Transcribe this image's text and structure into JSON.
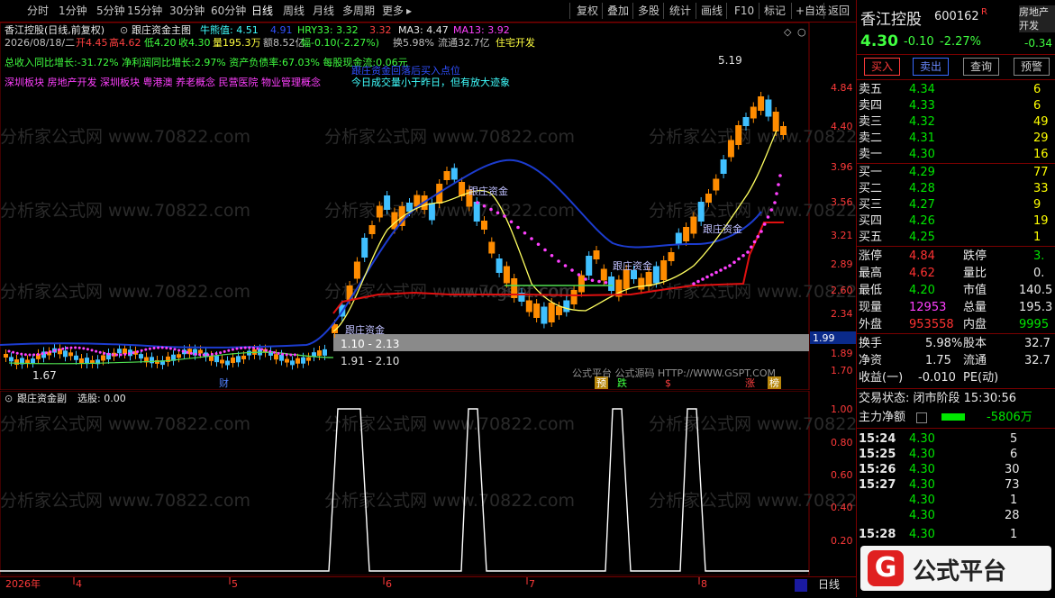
{
  "toolbar": {
    "periods": [
      "分时",
      "1分钟",
      "5分钟",
      "15分钟",
      "30分钟",
      "60分钟",
      "日线",
      "周线",
      "月线",
      "多周期",
      "更多"
    ],
    "actions": [
      "复权",
      "叠加",
      "多股",
      "统计",
      "画线",
      "F10",
      "标记",
      "+自选",
      "返回"
    ]
  },
  "header": {
    "stock_line": "香江控股(日线,前复权)",
    "indicator_name": "跟庄资金主图",
    "niu_xiong": "牛熊值: 4.51",
    "hidden_val": "4.91",
    "hry33": "HRY33: 3.32",
    "hry_val": "3.32",
    "ma3": "MA3: 4.47",
    "ma13": "MA13: 3.92",
    "date": "2026/08/18/二",
    "open": "开4.45",
    "high": "高4.62",
    "low": "低4.20",
    "close": "收4.30",
    "volume": "量195.3万",
    "amount": "额8.52亿",
    "amp": "幅-0.10(-2.27%)",
    "turnover": "换5.98%",
    "float": "流通32.7亿",
    "sector": "住宅开发",
    "fund_line": "总收入同比增长:-31.72%  净利润同比增长:2.97%  资产负债率:67.03%  每股现金流:0.06元",
    "concept_line": "深圳板块  房地产开发  深圳板块  粤港澳  养老概念  民营医院  物业管理概念",
    "note": "今日成交量小于昨日，但有放大迹象",
    "watermark_tip": "跟庄资金回落后买入点位"
  },
  "main_chart": {
    "price_ticks": [
      "4.84",
      "4.40",
      "3.96",
      "3.56",
      "3.21",
      "2.89",
      "2.60",
      "2.34",
      "2.10",
      "1.89",
      "1.70"
    ],
    "current_price_tag": "1.99",
    "high_label": "5.19",
    "low_label": "1.67",
    "box_top": "1.10 - 2.13",
    "box_bottom": "1.91 - 2.10",
    "annotations": [
      "跟庄资金",
      "跟庄资金",
      "跟庄资金",
      "跟庄资金"
    ],
    "event_markers": [
      "财",
      "预",
      "跌",
      "$",
      "涨",
      "榜"
    ],
    "source_text": "公式平台   公式源码 HTTP://WWW.GSPT.COM",
    "watermark": "分析家公式网 www.70822.com",
    "watermark2": "www.gspt.com"
  },
  "sub_chart": {
    "title": "跟庄资金副",
    "select_label": "选股: 0.00",
    "ticks": [
      "1.00",
      "0.80",
      "0.60",
      "0.40",
      "0.20"
    ]
  },
  "x_axis": {
    "labels": [
      "2026年",
      "4",
      "5",
      "6",
      "7",
      "8"
    ],
    "period_button": "日线"
  },
  "right_panel": {
    "name": "香江控股",
    "code": "600162",
    "flag": "R",
    "sector_tag": "房地产开发",
    "price": "4.30",
    "change": "-0.10",
    "pct": "-2.27%",
    "sector_change": "-0.34",
    "buttons": [
      "买入",
      "卖出",
      "查询",
      "预警"
    ],
    "asks": [
      {
        "label": "卖五",
        "price": "4.34",
        "vol": "6"
      },
      {
        "label": "卖四",
        "price": "4.33",
        "vol": "6"
      },
      {
        "label": "卖三",
        "price": "4.32",
        "vol": "49"
      },
      {
        "label": "卖二",
        "price": "4.31",
        "vol": "29"
      },
      {
        "label": "卖一",
        "price": "4.30",
        "vol": "16"
      }
    ],
    "bids": [
      {
        "label": "买一",
        "price": "4.29",
        "vol": "77"
      },
      {
        "label": "买二",
        "price": "4.28",
        "vol": "33"
      },
      {
        "label": "买三",
        "price": "4.27",
        "vol": "9"
      },
      {
        "label": "买四",
        "price": "4.26",
        "vol": "19"
      },
      {
        "label": "买五",
        "price": "4.25",
        "vol": "1"
      }
    ],
    "stats": [
      {
        "l1": "涨停",
        "v1": "4.84",
        "l2": "跌停",
        "v2": "3."
      },
      {
        "l1": "最高",
        "v1": "4.62",
        "l2": "量比",
        "v2": "0."
      },
      {
        "l1": "最低",
        "v1": "4.20",
        "l2": "市值",
        "v2": "140.5"
      },
      {
        "l1": "现量",
        "v1": "12953",
        "l2": "总量",
        "v2": "195.3"
      },
      {
        "l1": "外盘",
        "v1": "953558",
        "l2": "内盘",
        "v2": "9995"
      }
    ],
    "stats2": [
      {
        "l1": "换手",
        "v1": "5.98%",
        "l2": "股本",
        "v2": "32.7"
      },
      {
        "l1": "净资",
        "v1": "1.75",
        "l2": "流通",
        "v2": "32.7"
      },
      {
        "l1": "收益(一)",
        "v1": "-0.010",
        "l2": "PE(动)",
        "v2": ""
      }
    ],
    "trade_status": "交易状态: 闭市阶段  15:30:56",
    "main_net_label": "主力净额",
    "main_net_value": "-5806万",
    "ticks": [
      {
        "t": "15:24",
        "p": "4.30",
        "v": "5"
      },
      {
        "t": "15:25",
        "p": "4.30",
        "v": "6"
      },
      {
        "t": "15:26",
        "p": "4.30",
        "v": "30"
      },
      {
        "t": "15:27",
        "p": "4.30",
        "v": "73"
      },
      {
        "t": "",
        "p": "4.30",
        "v": "1"
      },
      {
        "t": "",
        "p": "4.30",
        "v": "28"
      },
      {
        "t": "15:28",
        "p": "4.30",
        "v": "1"
      }
    ],
    "logo_text": "公式平台",
    "logo_letter": "G"
  }
}
